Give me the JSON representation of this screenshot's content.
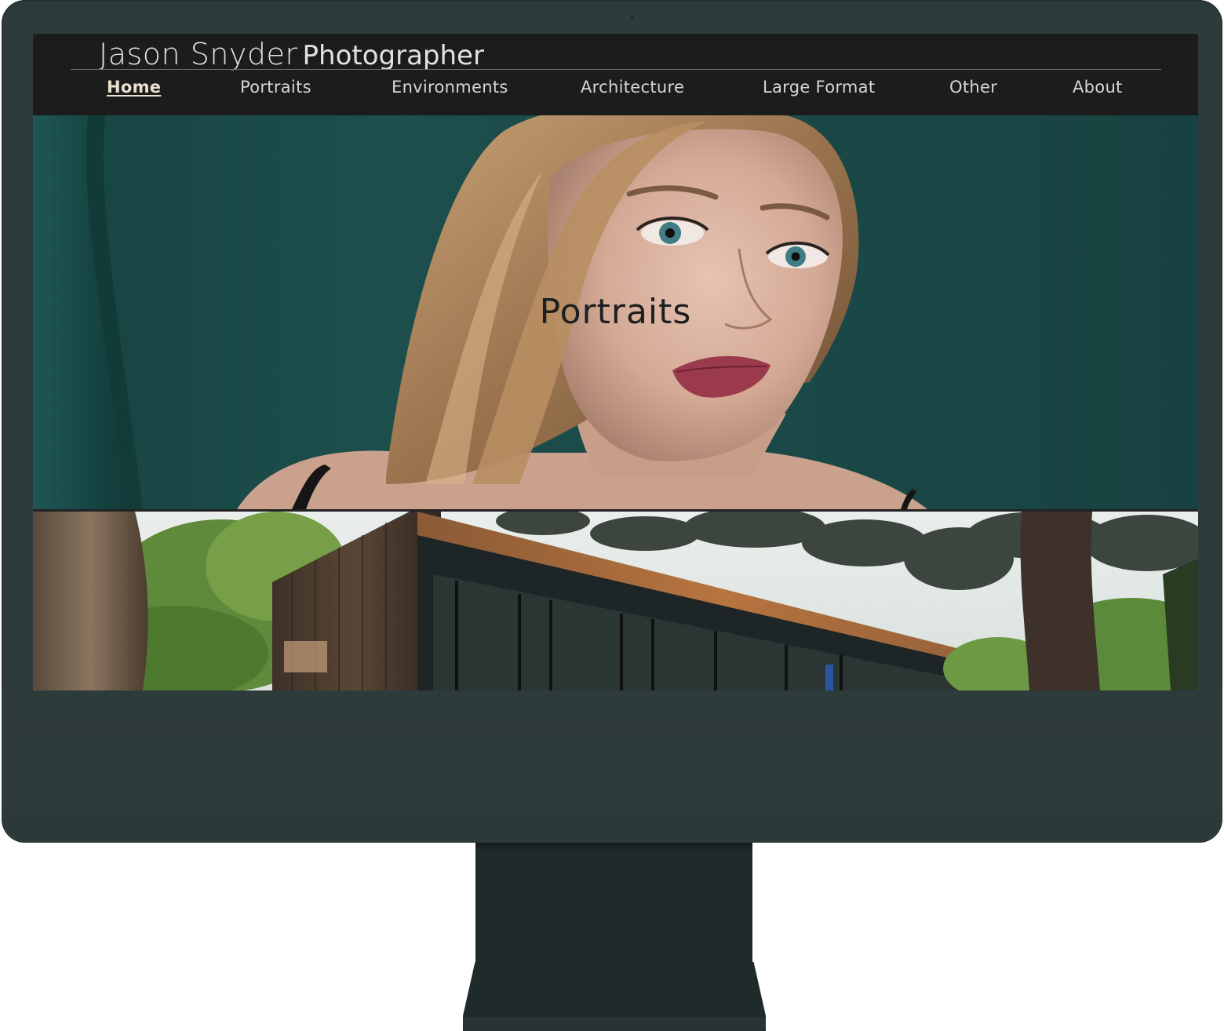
{
  "site": {
    "name": "Jason Snyder",
    "role": "Photographer"
  },
  "nav": {
    "items": [
      {
        "label": "Home",
        "active": true
      },
      {
        "label": "Portraits",
        "active": false
      },
      {
        "label": "Environments",
        "active": false
      },
      {
        "label": "Architecture",
        "active": false
      },
      {
        "label": "Large Format",
        "active": false
      },
      {
        "label": "Other",
        "active": false
      },
      {
        "label": "About",
        "active": false
      }
    ]
  },
  "hero": {
    "overlay_label": "Portraits"
  },
  "colors": {
    "monitor_body": "#2e3b3b",
    "header_bg": "#1c1c1c",
    "hero_teal": "#1b4a49"
  }
}
